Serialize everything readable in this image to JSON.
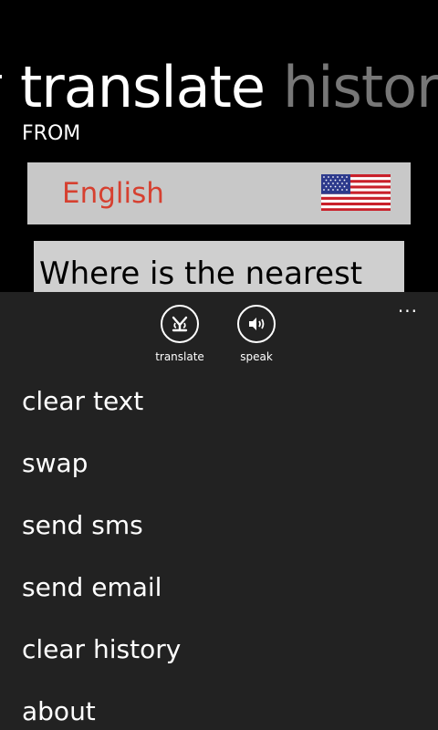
{
  "pivot": {
    "active": "translate",
    "next": "history"
  },
  "source": {
    "label": "FROM",
    "language": "English",
    "flag_icon": "us-flag-icon",
    "text": "Where is the nearest"
  },
  "appbar": {
    "overflow": "...",
    "buttons": [
      {
        "label": "translate",
        "icon": "translate-icon"
      },
      {
        "label": "speak",
        "icon": "speaker-icon"
      }
    ],
    "menu": [
      "clear text",
      "swap",
      "send sms",
      "send email",
      "clear history",
      "about"
    ]
  },
  "colors": {
    "accent_text": "#d64030",
    "appbar_bg": "#222222",
    "box_bg": "#c8c8c8"
  }
}
